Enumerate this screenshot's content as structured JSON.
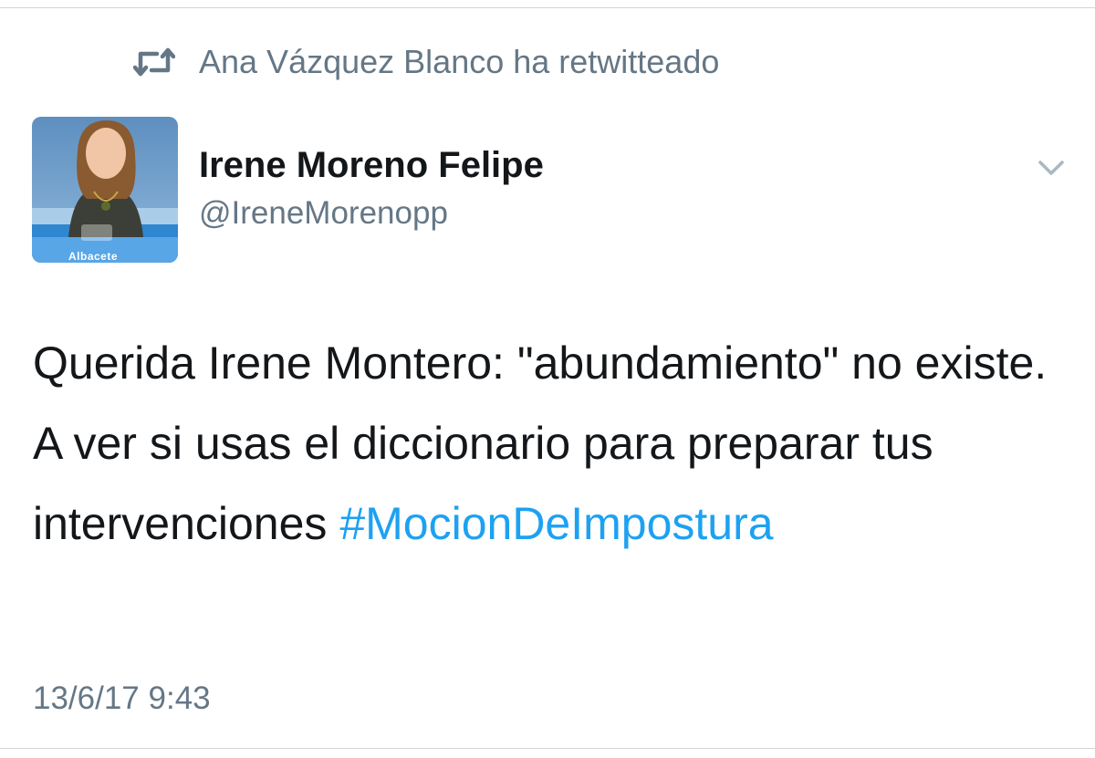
{
  "retweet": {
    "icon": "retweet-icon",
    "text": "Ana Vázquez Blanco ha retwitteado"
  },
  "author": {
    "avatar_text": "Albacete",
    "name": "Irene Moreno Felipe",
    "handle": "@IreneMorenopp"
  },
  "menu": {
    "icon": "chevron-down-icon"
  },
  "tweet": {
    "text": "Querida Irene Montero: \"abundamiento\" no existe. A ver si usas el diccionario para preparar tus intervenciones",
    "hashtag": "#MocionDeImpostura",
    "timestamp": "13/6/17 9:43"
  },
  "colors": {
    "text": "#14171a",
    "secondary": "#657786",
    "link": "#1da1f2",
    "divider": "#d4d4d4"
  }
}
